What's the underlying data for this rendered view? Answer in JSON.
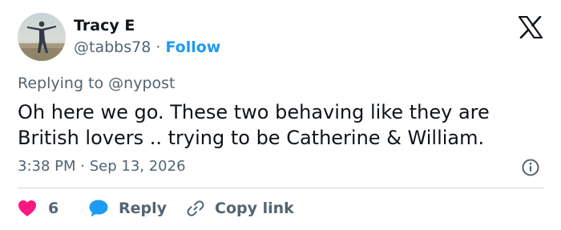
{
  "author": {
    "display_name": "Tracy E",
    "handle": "@tabbs78",
    "separator": "·",
    "follow_label": "Follow"
  },
  "tweet": {
    "replying_prefix": "Replying to",
    "replying_to": "@nypost",
    "text_line1": "Oh here we go. These two behaving like they are",
    "text_line2": "British lovers .. trying to be Catherine & William.",
    "time": "3:38 PM",
    "date_separator": "·",
    "date": "Sep 13, 2026"
  },
  "actions": {
    "like_count": "6",
    "reply_label": "Reply",
    "copy_link_label": "Copy link"
  },
  "icons": {
    "brand": "x-logo-icon",
    "info": "info-icon",
    "like": "heart-icon",
    "reply": "speech-bubble-icon",
    "copy": "link-icon"
  },
  "colors": {
    "text": "#0f1419",
    "secondary": "#536471",
    "follow": "#1d9bf0",
    "like": "#f91880",
    "reply": "#1d9bf0",
    "divider": "#cfd9de"
  }
}
